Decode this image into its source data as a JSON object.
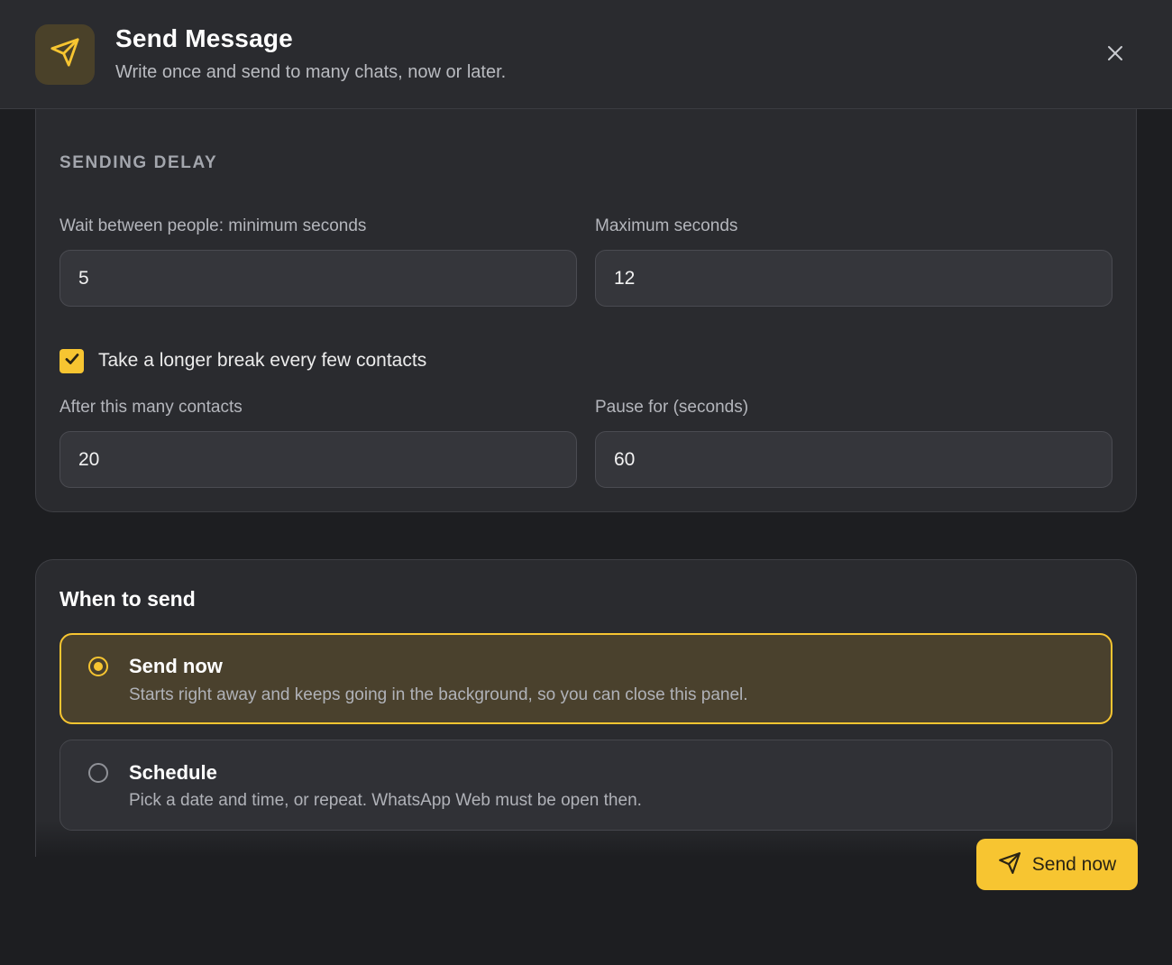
{
  "header": {
    "title": "Send Message",
    "subtitle": "Write once and send to many chats, now or later.",
    "icon": "send-icon",
    "close_icon": "close-icon"
  },
  "delay": {
    "section_title": "SENDING DELAY",
    "min_label": "Wait between people: minimum seconds",
    "min_value": "5",
    "max_label": "Maximum seconds",
    "max_value": "12",
    "break_checkbox_label": "Take a longer break every few contacts",
    "break_checked": true,
    "after_label": "After this many contacts",
    "after_value": "20",
    "pause_label": "Pause for (seconds)",
    "pause_value": "60"
  },
  "when": {
    "title": "When to send",
    "options": [
      {
        "title": "Send now",
        "description": "Starts right away and keeps going in the background, so you can close this panel.",
        "selected": true
      },
      {
        "title": "Schedule",
        "description": "Pick a date and time, or repeat. WhatsApp Web must be open then.",
        "selected": false
      }
    ]
  },
  "footer": {
    "send_label": "Send now"
  },
  "colors": {
    "accent": "#f7c531",
    "background": "#1d1e21",
    "card": "#2a2b2f",
    "selected_option_bg": "#4a412d"
  }
}
